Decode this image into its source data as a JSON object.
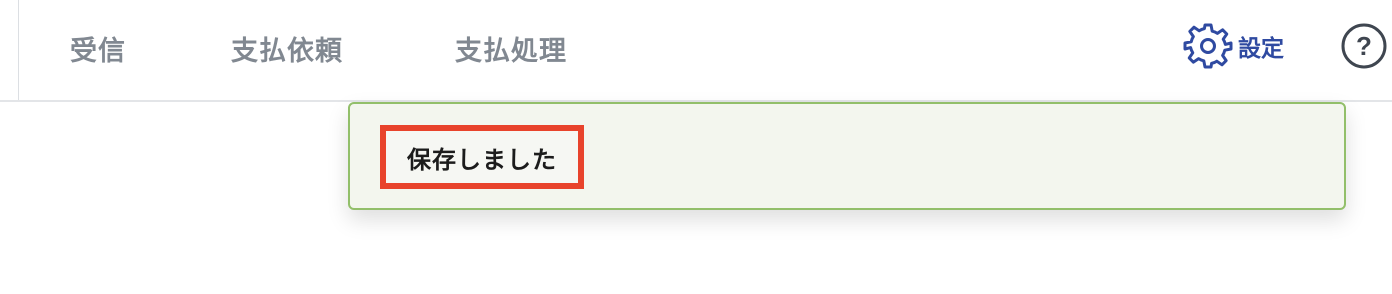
{
  "header": {
    "nav_items": [
      {
        "label": "受信"
      },
      {
        "label": "支払依頼"
      },
      {
        "label": "支払処理"
      }
    ],
    "settings": {
      "label": "設定",
      "icon": "gear-icon",
      "color": "#2f4aa1"
    },
    "help": {
      "icon": "help-icon",
      "glyph": "?"
    }
  },
  "toast": {
    "message": "保存しました",
    "background": "#f3f6ee",
    "border_color": "#92bf6a",
    "highlight_color": "#e8432b"
  }
}
